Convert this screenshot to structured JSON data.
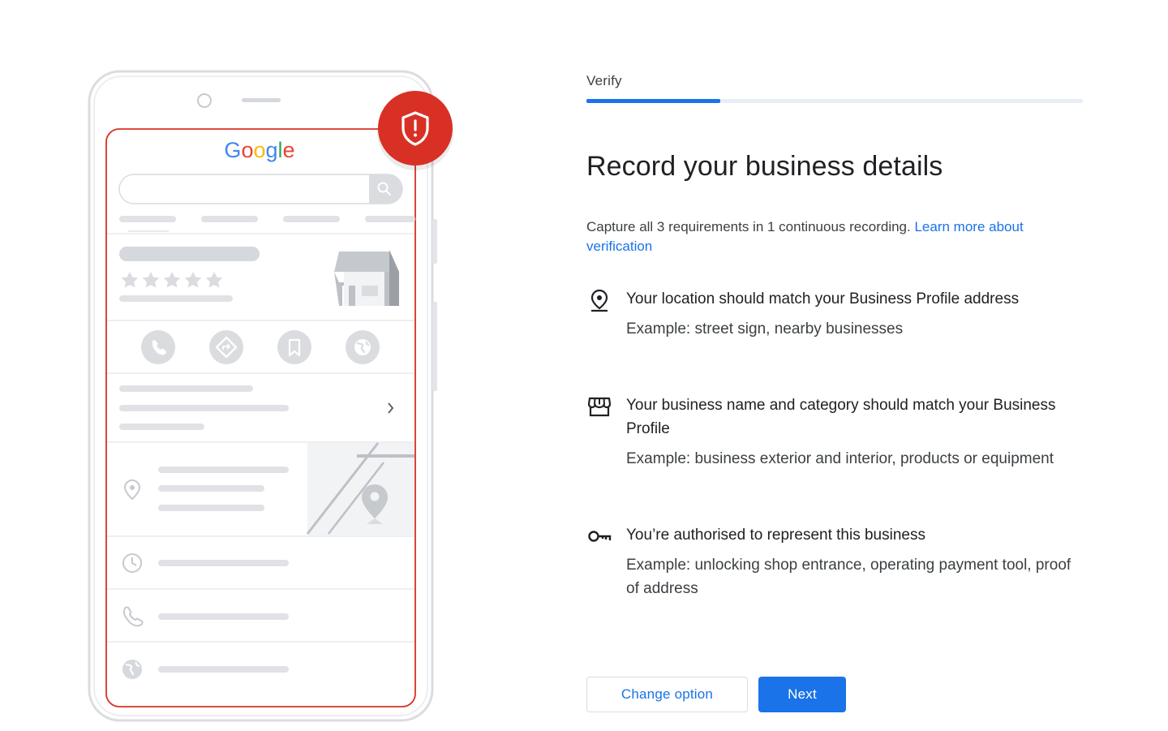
{
  "illustration": {
    "logo_text": "Google",
    "logo_colors": [
      "#4285f4",
      "#ea4335",
      "#fbbc05",
      "#4285f4",
      "#34a853",
      "#ea4335"
    ],
    "badge_icon": "shield-alert-icon",
    "badge_color": "#d93025",
    "frame_color": "#d93025"
  },
  "step": {
    "label": "Verify",
    "progress": 0.27,
    "accent": "#1a73e8"
  },
  "title": "Record your business details",
  "intro": {
    "text": "Capture all 3 requirements in 1 continuous recording.",
    "link": "Learn more about verification"
  },
  "requirements": [
    {
      "icon": "location-pin-icon",
      "title": "Your location should match your Business Profile address",
      "example": "Example: street sign, nearby businesses"
    },
    {
      "icon": "storefront-icon",
      "title": "Your business name and category should match your Business Profile",
      "example": "Example: business exterior and interior, products or equipment"
    },
    {
      "icon": "key-icon",
      "title": "You’re authorised to represent this business",
      "example": "Example: unlocking shop entrance, operating payment tool, proof of address"
    }
  ],
  "buttons": {
    "change_option": "Change option",
    "next": "Next"
  }
}
